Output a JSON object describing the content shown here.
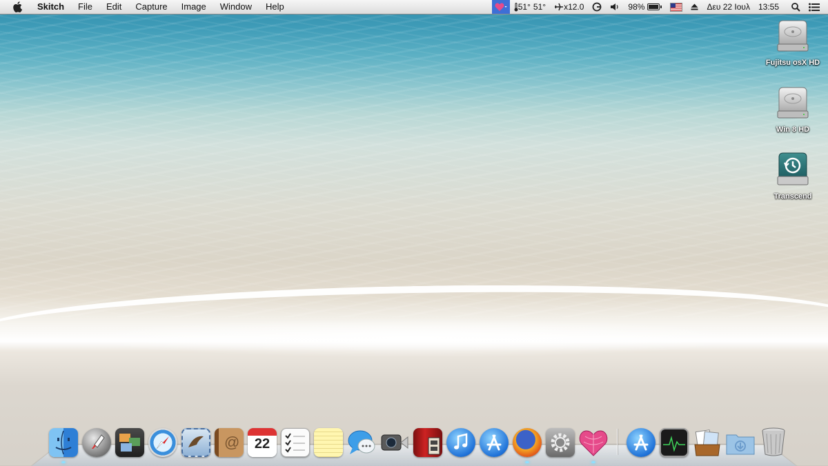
{
  "menubar": {
    "app_name": "Skitch",
    "menus": [
      "File",
      "Edit",
      "Capture",
      "Image",
      "Window",
      "Help"
    ],
    "status": {
      "temperature": "51°",
      "temperature2": "51°",
      "speed": "x12.0",
      "battery_percent": "98%",
      "battery_level": 0.98,
      "date": "Δευ 22 Ιουλ",
      "time": "13:55"
    }
  },
  "desktop_icons": [
    {
      "label": "Fujitsu osX HD",
      "icon": "hard-drive-icon"
    },
    {
      "label": "Win 8 HD",
      "icon": "hard-drive-icon"
    },
    {
      "label": "Transcend",
      "icon": "time-machine-drive-icon"
    }
  ],
  "dock": {
    "apps": [
      {
        "id": "finder",
        "icon": "finder-icon",
        "running": true
      },
      {
        "id": "launchpad",
        "icon": "rocket-icon",
        "running": false
      },
      {
        "id": "photo-booth",
        "icon": "photos-icon",
        "running": false
      },
      {
        "id": "safari",
        "icon": "compass-icon",
        "running": false
      },
      {
        "id": "mail",
        "icon": "mail-icon",
        "running": false
      },
      {
        "id": "contacts",
        "icon": "address-book-icon",
        "running": false
      },
      {
        "id": "calendar",
        "icon": "calendar-icon",
        "running": false,
        "text": "22"
      },
      {
        "id": "reminders",
        "icon": "checklist-icon",
        "running": false
      },
      {
        "id": "notes",
        "icon": "notepad-icon",
        "running": false
      },
      {
        "id": "messages",
        "icon": "chat-bubble-icon",
        "running": false
      },
      {
        "id": "facetime",
        "icon": "camera-icon",
        "running": false
      },
      {
        "id": "dvd-player",
        "icon": "film-icon",
        "running": false
      },
      {
        "id": "itunes",
        "icon": "music-note-icon",
        "running": false
      },
      {
        "id": "app-store",
        "icon": "app-store-icon",
        "running": false
      },
      {
        "id": "firefox",
        "icon": "firefox-icon",
        "running": true
      },
      {
        "id": "system-preferences",
        "icon": "gear-icon",
        "running": false
      },
      {
        "id": "heart-app",
        "icon": "heart-icon",
        "running": true
      }
    ],
    "stacks": [
      {
        "id": "applications",
        "icon": "app-store-icon"
      },
      {
        "id": "activity-monitor",
        "icon": "activity-monitor-icon"
      },
      {
        "id": "documents",
        "icon": "documents-stack-icon"
      },
      {
        "id": "downloads",
        "icon": "downloads-folder-icon"
      },
      {
        "id": "trash",
        "icon": "trash-icon"
      }
    ]
  },
  "colors": {
    "menubar_highlight": "#3d6fd6",
    "running_indicator": "#8fe0ff"
  }
}
